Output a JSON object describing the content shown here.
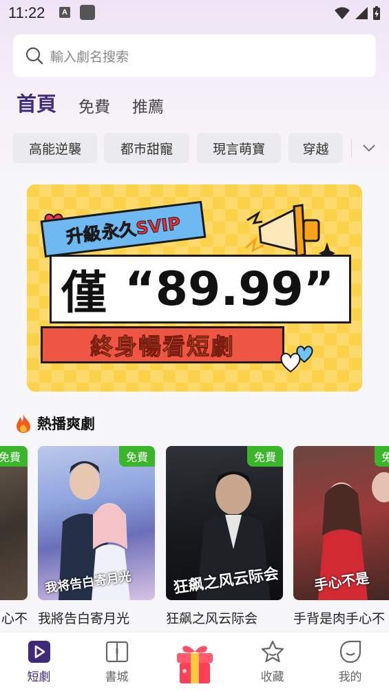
{
  "status_bar": {
    "time": "11:22",
    "notification_letter": "A"
  },
  "search": {
    "placeholder": "輸入劇名搜索"
  },
  "top_tabs": [
    {
      "label": "首頁",
      "active": true
    },
    {
      "label": "免費",
      "active": false
    },
    {
      "label": "推薦",
      "active": false
    }
  ],
  "genre_chips": [
    "高能逆襲",
    "都市甜寵",
    "現言萌寶",
    "穿越"
  ],
  "banner": {
    "ribbon_prefix": "升級",
    "ribbon_highlight": "永久SVIP",
    "price_label": "僅",
    "price_value": "“89.99”",
    "subtitle": "終身暢看短劇"
  },
  "hot_section": {
    "title": "熱播爽劇",
    "icon": "fire-icon"
  },
  "cards": [
    {
      "title": "心不",
      "badge": "免費",
      "caption": ""
    },
    {
      "title": "我將告白寄月光",
      "badge": "免費",
      "caption": "我将告白寄月光"
    },
    {
      "title": "狂飙之风云际会",
      "badge": "免費",
      "caption": "狂飙之风云际会"
    },
    {
      "title": "手背是肉手心不",
      "badge": "免費",
      "caption": "手心不是"
    }
  ],
  "tabbar": [
    {
      "label": "短劇",
      "icon": "play-icon",
      "active": true
    },
    {
      "label": "書城",
      "icon": "book-icon",
      "active": false
    },
    {
      "label": "",
      "icon": "gift-icon",
      "active": false
    },
    {
      "label": "收藏",
      "icon": "star-icon",
      "active": false
    },
    {
      "label": "我的",
      "icon": "profile-icon",
      "active": false
    }
  ],
  "colors": {
    "accent": "#3d2a7a",
    "free_badge": "#3bb52a",
    "banner_yellow": "#fcd24a"
  }
}
